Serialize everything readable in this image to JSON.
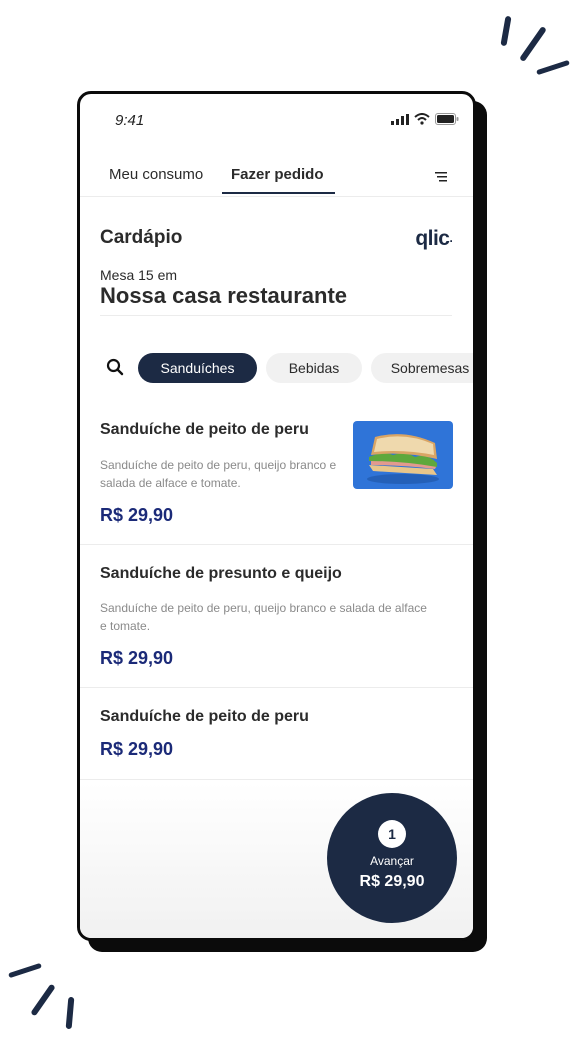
{
  "status_bar": {
    "time": "9:41"
  },
  "tabs": [
    {
      "label": "Meu consumo",
      "active": false
    },
    {
      "label": "Fazer pedido",
      "active": true
    }
  ],
  "header": {
    "title": "Cardápio",
    "logo": "qlic",
    "table_label": "Mesa 15 em",
    "restaurant": "Nossa casa restaurante"
  },
  "categories": [
    {
      "label": "Sanduíches",
      "active": true
    },
    {
      "label": "Bebidas",
      "active": false
    },
    {
      "label": "Sobremesas",
      "active": false
    }
  ],
  "items": [
    {
      "name": "Sanduíche de peito de peru",
      "description": "Sanduíche de peito de peru, queijo branco e salada de alface e tomate.",
      "price": "R$ 29,90"
    },
    {
      "name": "Sanduíche de presunto e queijo",
      "description": "Sanduíche de peito de peru, queijo branco e salada de alface e tomate.",
      "price": "R$ 29,90"
    },
    {
      "name": "Sanduíche de peito de peru",
      "price": "R$ 29,90"
    }
  ],
  "cart": {
    "count": "1",
    "label": "Avançar",
    "total": "R$ 29,90"
  },
  "colors": {
    "brand_dark": "#1c2a44",
    "price_blue": "#1b2a78",
    "image_bg": "#2f74d8"
  }
}
